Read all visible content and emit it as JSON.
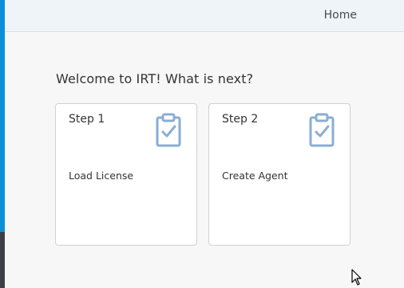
{
  "header": {
    "home_label": "Home"
  },
  "main": {
    "welcome_text": "Welcome to IRT! What is next?",
    "cards": [
      {
        "title": "Step 1",
        "subtitle": "Load License",
        "icon": "clipboard-check-icon"
      },
      {
        "title": "Step 2",
        "subtitle": "Create Agent",
        "icon": "clipboard-check-icon"
      }
    ]
  },
  "colors": {
    "accent_blue": "#0a8fd8",
    "icon_blue": "#8aaed3",
    "header_bg": "#eff4f9"
  }
}
